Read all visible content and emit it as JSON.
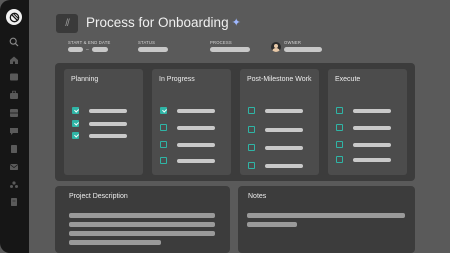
{
  "header": {
    "title": "Process for Onboarding",
    "icon": "text-format-icon",
    "sparkle_icon": "sparkle-icon"
  },
  "meta": {
    "dates_label": "START & END DATE",
    "status_label": "STATUS",
    "process_label": "PROCESS",
    "owner_label": "OWNER"
  },
  "sidebar": {
    "logo": "app-logo-icon",
    "icons": [
      "search-icon",
      "home-icon",
      "inbox-icon",
      "briefcase-icon",
      "grid-icon",
      "chat-icon",
      "document-icon",
      "mail-icon",
      "people-icon",
      "page-icon"
    ]
  },
  "columns": [
    {
      "title": "Planning",
      "tasks": [
        true,
        true,
        true
      ]
    },
    {
      "title": "In Progress",
      "tasks": [
        true,
        false,
        false,
        false
      ]
    },
    {
      "title": "Post-Milestone Work",
      "tasks": [
        false,
        false,
        false,
        false
      ]
    },
    {
      "title": "Execute",
      "tasks": [
        false,
        false,
        false,
        false
      ]
    }
  ],
  "panels": {
    "description_title": "Project Description",
    "notes_title": "Notes"
  },
  "colors": {
    "accent": "#2fb5a6",
    "background": "#5a5a5a",
    "sidebar": "#161616",
    "card": "#3c3c3c"
  }
}
